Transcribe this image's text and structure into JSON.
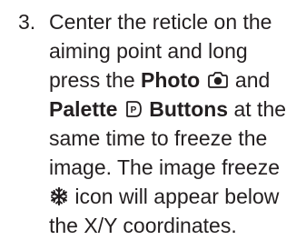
{
  "instruction": {
    "step_number": "3.",
    "line1": "Center the reticle on the",
    "line2": "aiming point and long",
    "line3_pre": "press the ",
    "photo_label": "Photo",
    "line3_post": " and",
    "palette_label": "Palette",
    "buttons_label": "Buttons",
    "line4_post": " at the",
    "line5": "same time to freeze the",
    "line6": "image. The image freeze",
    "line7_post": " icon will appear below",
    "line8": "the X/Y coordinates.",
    "icons": {
      "photo": "camera-icon",
      "palette": "palette-p-icon",
      "freeze": "snowflake-icon"
    },
    "colors": {
      "text": "#231f20"
    }
  }
}
